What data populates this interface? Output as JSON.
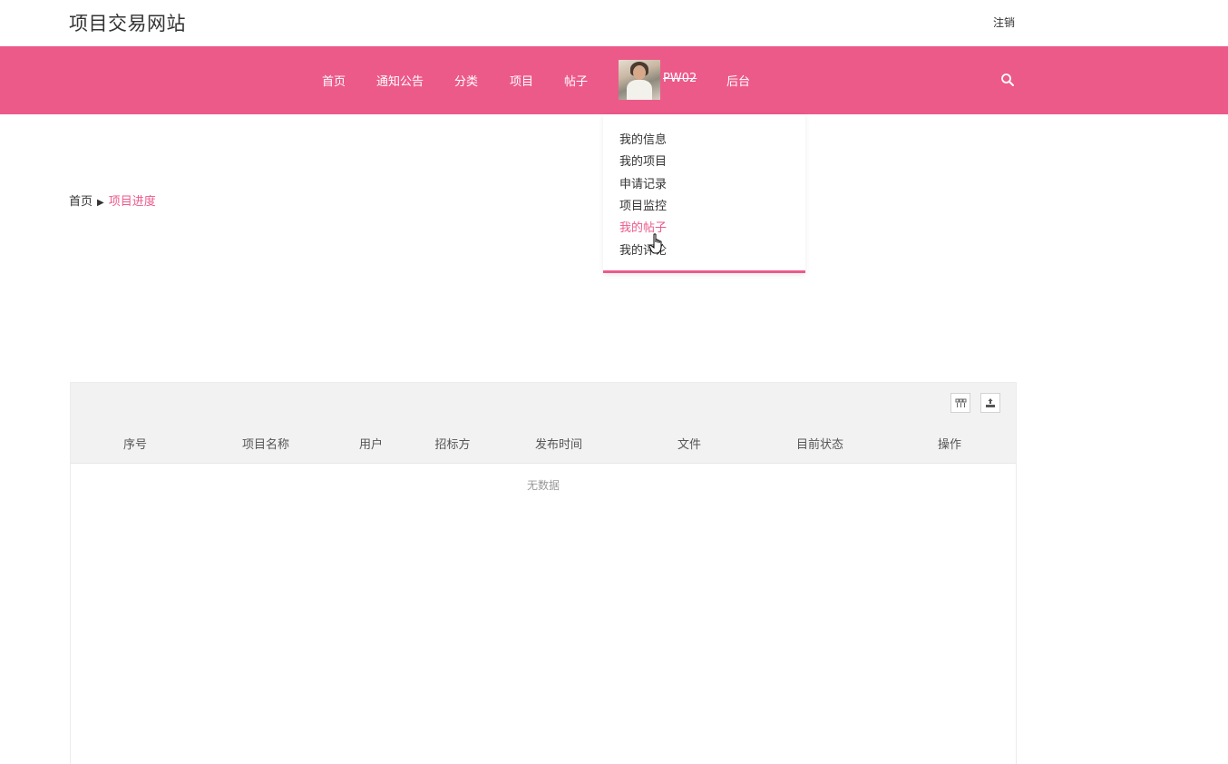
{
  "header": {
    "site_title": "项目交易网站",
    "logout_label": "注销"
  },
  "nav": {
    "items": [
      "首页",
      "通知公告",
      "分类",
      "项目",
      "帖子"
    ],
    "username": "PW02",
    "admin_label": "后台",
    "accent_color": "#ec5a8a"
  },
  "user_menu": {
    "items": [
      "我的信息",
      "我的项目",
      "申请记录",
      "项目监控",
      "我的帖子",
      "我的评论"
    ]
  },
  "breadcrumb": {
    "home": "首页",
    "separator": "▶",
    "current": "项目进度"
  },
  "table": {
    "columns": [
      "序号",
      "项目名称",
      "用户",
      "招标方",
      "发布时间",
      "文件",
      "目前状态",
      "操作"
    ],
    "empty_text": "无数据",
    "tools": [
      "columns-icon",
      "export-icon"
    ]
  }
}
